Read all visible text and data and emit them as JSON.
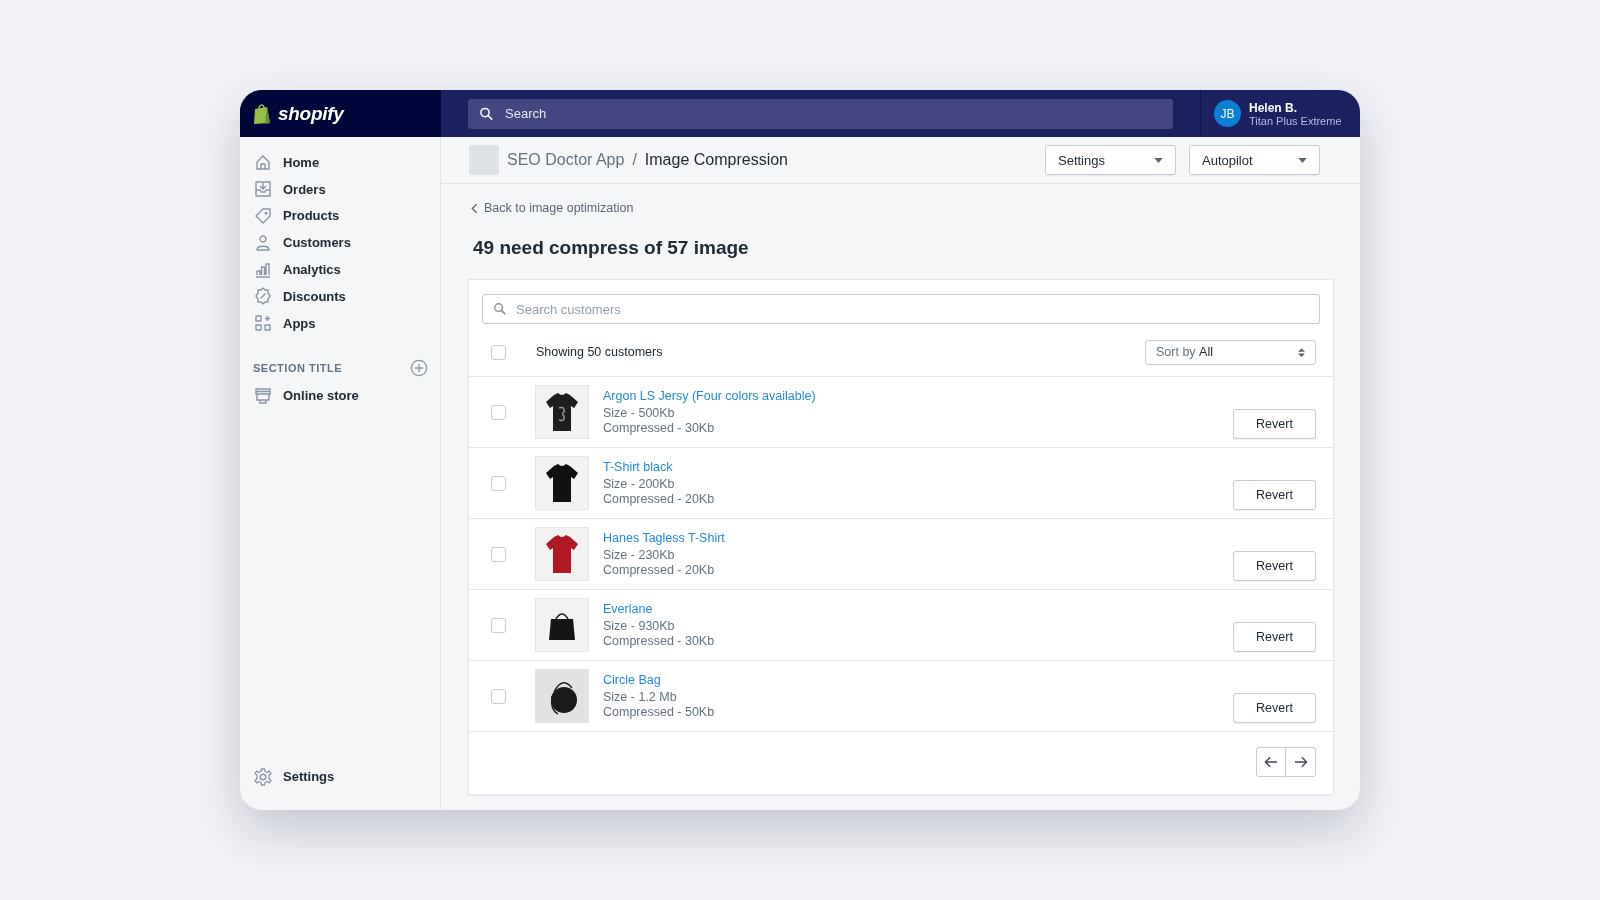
{
  "topbar": {
    "logo": "shopify",
    "search": {
      "placeholder": "Search"
    },
    "user": {
      "initials": "JB",
      "name": "Helen B.",
      "store": "Titan Plus Extreme"
    }
  },
  "sidebar": {
    "items": [
      {
        "label": "Home",
        "selected": false
      },
      {
        "label": "Orders",
        "selected": false
      },
      {
        "label": "Products",
        "selected": false
      },
      {
        "label": "Customers",
        "selected": false
      },
      {
        "label": "Analytics",
        "selected": false
      },
      {
        "label": "Discounts",
        "selected": false
      },
      {
        "label": "Apps",
        "selected": false
      }
    ],
    "section": {
      "title": "SECTION TITLE",
      "items": [
        {
          "label": "Online store",
          "selected": false
        }
      ]
    },
    "footer": {
      "label": "Settings",
      "selected": false
    }
  },
  "header": {
    "breadcrumb": "SEO Doctor App",
    "separator": "/",
    "title": "Image Compression",
    "dropdowns": [
      "Settings",
      "Autopilot"
    ]
  },
  "back_link": "Back to image optimization",
  "heading": "49 need compress of 57 image",
  "list": {
    "search": {
      "placeholder": "Search customers"
    },
    "select_all": {
      "checked": false
    },
    "count": "Showing 50 customers",
    "sort": {
      "label": "Sort by",
      "value": "All"
    },
    "rows": [
      {
        "checked": false,
        "name": "Argon LS Jersy (Four colors available)",
        "size": "Size - 500Kb",
        "compressed": "Compressed - 30Kb",
        "action": "Revert"
      },
      {
        "checked": false,
        "name": "T-Shirt black",
        "size": "Size - 200Kb",
        "compressed": "Compressed - 20Kb",
        "action": "Revert"
      },
      {
        "checked": false,
        "name": "Hanes Tagless T-Shirt",
        "size": "Size - 230Kb",
        "compressed": "Compressed - 20Kb",
        "action": "Revert"
      },
      {
        "checked": false,
        "name": "Everlane",
        "size": "Size - 930Kb",
        "compressed": "Compressed - 30Kb",
        "action": "Revert"
      },
      {
        "checked": false,
        "name": "Circle Bag",
        "size": "Size - 1.2 Mb",
        "compressed": "Compressed - 50Kb",
        "action": "Revert"
      }
    ]
  }
}
